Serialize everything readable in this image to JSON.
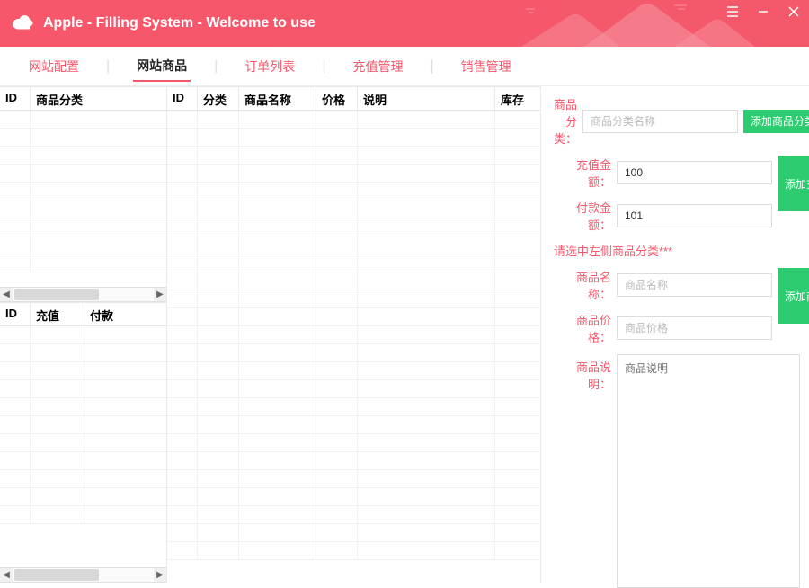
{
  "header": {
    "title": "Apple - Filling System - Welcome to use"
  },
  "tabs": [
    {
      "label": "网站配置",
      "active": false
    },
    {
      "label": "网站商品",
      "active": true
    },
    {
      "label": "订单列表",
      "active": false
    },
    {
      "label": "充值管理",
      "active": false
    },
    {
      "label": "销售管理",
      "active": false
    }
  ],
  "category_grid": {
    "headers": {
      "id": "ID",
      "name": "商品分类"
    }
  },
  "recharge_grid": {
    "headers": {
      "id": "ID",
      "charge": "充值",
      "pay": "付款"
    }
  },
  "product_grid": {
    "headers": {
      "id": "ID",
      "cat": "分类",
      "name": "商品名称",
      "price": "价格",
      "desc": "说明",
      "stock": "库存"
    }
  },
  "right": {
    "category": {
      "label": "商品分类：",
      "placeholder": "商品分类名称",
      "btn": "添加商品分类"
    },
    "recharge": {
      "amount_label": "充值金额：",
      "amount_value": "100",
      "pay_label": "付款金额：",
      "pay_value": "101",
      "btn": "添加充值列表"
    },
    "hint": "请选中左侧商品分类***",
    "product": {
      "name_label": "商品名称：",
      "name_placeholder": "商品名称",
      "price_label": "商品价格：",
      "price_placeholder": "商品价格",
      "btn": "添加商品名称",
      "desc_label": "商品说明：",
      "desc_placeholder": "商品说明"
    }
  },
  "colors": {
    "accent": "#f6576a",
    "green": "#2ecc71"
  }
}
